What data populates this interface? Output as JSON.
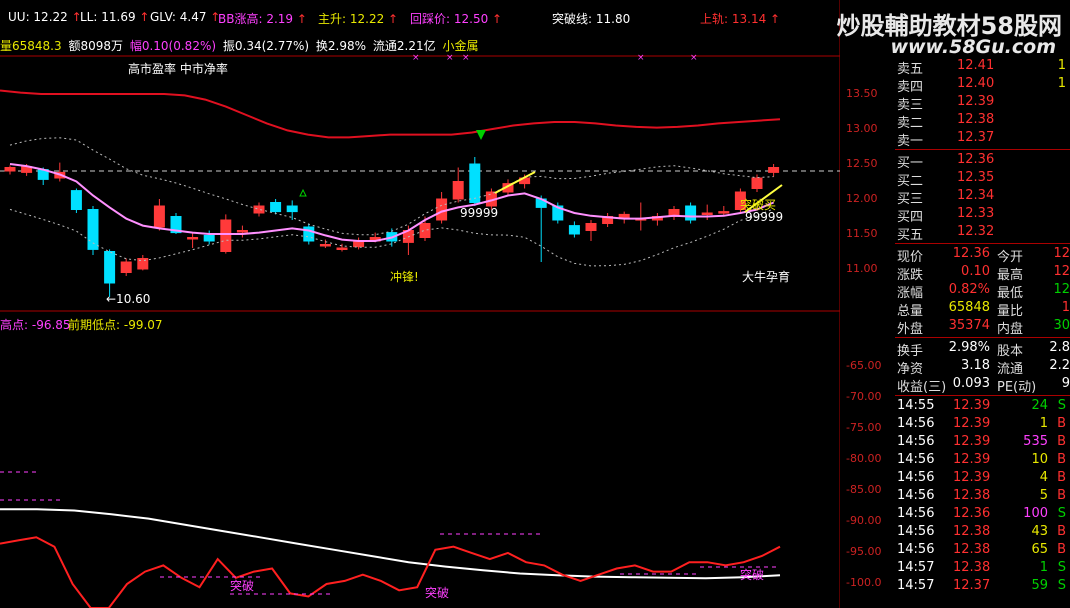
{
  "top_indicators": [
    {
      "label": "UU: 12.22",
      "arrow": "↑",
      "color": "#ffffff"
    },
    {
      "label": "LL: 11.69",
      "arrow": "↑",
      "color": "#ffffff"
    },
    {
      "label": "GLV: 4.47",
      "arrow": "↑",
      "color": "#ffffff"
    },
    {
      "label": "BB涨高: 2.19",
      "arrow": "↑",
      "color": "#ff40ff"
    },
    {
      "label": "主升: 12.22",
      "arrow": "↑",
      "color": "#e8e800"
    },
    {
      "label": "回踩价: 12.50",
      "arrow": "↑",
      "color": "#ff40ff"
    },
    {
      "label": "突破线: 11.80",
      "arrow": "",
      "color": "#ffffff"
    },
    {
      "label": "",
      "arrow": "",
      "color": "#3050ff"
    },
    {
      "label": "上轨: 13.14",
      "arrow": "↑",
      "color": "#ff3030"
    }
  ],
  "watermark": {
    "line1": "炒股輔助教材58股网",
    "line2": "www.58Gu.com"
  },
  "info_line": {
    "volume": "量65848.3",
    "amount": "额8098万",
    "change": "幅0.10(0.82%)",
    "amplitude": "振0.34(2.77%)",
    "turnover": "换2.98%",
    "float": "流通2.21亿",
    "sector": "小金属"
  },
  "chart_labels": {
    "pe_labels": "高市盈率 中市净率",
    "low_label": "←10.60",
    "rush_label": "冲锋!",
    "n99999_a": "99999",
    "n99999_b": "99999",
    "buy_label": "突破买",
    "pattern_label": "大牛孕育"
  },
  "lower_header": {
    "left": "高点: -96.85",
    "right": "前期低点: -99.07"
  },
  "lower_labels": {
    "breakout": "突破"
  },
  "y_axis_upper": [
    "13.50",
    "13.00",
    "12.50",
    "12.00",
    "11.50",
    "11.00"
  ],
  "y_axis_lower": [
    "-65.00",
    "-70.00",
    "-75.00",
    "-80.00",
    "-85.00",
    "-90.00",
    "-95.00",
    "-100.0"
  ],
  "order_book": {
    "asks": [
      {
        "label": "卖五",
        "price": "12.41",
        "vol": "1"
      },
      {
        "label": "卖四",
        "price": "12.40",
        "vol": "1"
      },
      {
        "label": "卖三",
        "price": "12.39",
        "vol": ""
      },
      {
        "label": "卖二",
        "price": "12.38",
        "vol": ""
      },
      {
        "label": "卖一",
        "price": "12.37",
        "vol": ""
      }
    ],
    "bids": [
      {
        "label": "买一",
        "price": "12.36",
        "vol": ""
      },
      {
        "label": "买二",
        "price": "12.35",
        "vol": ""
      },
      {
        "label": "买三",
        "price": "12.34",
        "vol": ""
      },
      {
        "label": "买四",
        "price": "12.33",
        "vol": ""
      },
      {
        "label": "买五",
        "price": "12.32",
        "vol": ""
      }
    ]
  },
  "stats": [
    {
      "l1": "现价",
      "v1": "12.36",
      "l2": "今开",
      "v2": "12"
    },
    {
      "l1": "涨跌",
      "v1": "0.10",
      "l2": "最高",
      "v2": "12"
    },
    {
      "l1": "涨幅",
      "v1": "0.82%",
      "l2": "最低",
      "v2": "12"
    },
    {
      "l1": "总量",
      "v1": "65848",
      "l2": "量比",
      "v2": "1"
    },
    {
      "l1": "外盘",
      "v1": "35374",
      "l2": "内盘",
      "v2": "30"
    }
  ],
  "stats2": [
    {
      "l1": "换手",
      "v1": "2.98%",
      "l2": "股本",
      "v2": "2.8"
    },
    {
      "l1": "净资",
      "v1": "3.18",
      "l2": "流通",
      "v2": "2.2"
    },
    {
      "l1": "收益(三)",
      "v1": "0.093",
      "l2": "PE(动)",
      "v2": "9"
    }
  ],
  "ticks": [
    {
      "time": "14:55",
      "price": "12.39",
      "vol": "24",
      "side": "S"
    },
    {
      "time": "14:56",
      "price": "12.39",
      "vol": "1",
      "side": "B"
    },
    {
      "time": "14:56",
      "price": "12.39",
      "vol": "535",
      "side": "B"
    },
    {
      "time": "14:56",
      "price": "12.39",
      "vol": "10",
      "side": "B"
    },
    {
      "time": "14:56",
      "price": "12.39",
      "vol": "4",
      "side": "B"
    },
    {
      "time": "14:56",
      "price": "12.38",
      "vol": "5",
      "side": "B"
    },
    {
      "time": "14:56",
      "price": "12.36",
      "vol": "100",
      "side": "S"
    },
    {
      "time": "14:56",
      "price": "12.38",
      "vol": "43",
      "side": "B"
    },
    {
      "time": "14:56",
      "price": "12.38",
      "vol": "65",
      "side": "B"
    },
    {
      "time": "14:57",
      "price": "12.38",
      "vol": "1",
      "side": "S"
    },
    {
      "time": "14:57",
      "price": "12.37",
      "vol": "59",
      "side": "S"
    }
  ],
  "candles": [
    {
      "o": 12.4,
      "c": 12.45,
      "h": 12.48,
      "l": 12.35
    },
    {
      "o": 12.38,
      "c": 12.46,
      "h": 12.5,
      "l": 12.33
    },
    {
      "o": 12.42,
      "c": 12.28,
      "h": 12.45,
      "l": 12.2
    },
    {
      "o": 12.3,
      "c": 12.38,
      "h": 12.52,
      "l": 12.25
    },
    {
      "o": 12.12,
      "c": 11.85,
      "h": 12.15,
      "l": 11.8
    },
    {
      "o": 11.85,
      "c": 11.28,
      "h": 11.9,
      "l": 11.2
    },
    {
      "o": 11.25,
      "c": 10.8,
      "h": 11.28,
      "l": 10.6
    },
    {
      "o": 10.95,
      "c": 11.1,
      "h": 11.15,
      "l": 10.9
    },
    {
      "o": 11.0,
      "c": 11.15,
      "h": 11.2,
      "l": 10.98
    },
    {
      "o": 11.6,
      "c": 11.9,
      "h": 12.0,
      "l": 11.55
    },
    {
      "o": 11.75,
      "c": 11.52,
      "h": 11.8,
      "l": 11.5
    },
    {
      "o": 11.45,
      "c": 11.45,
      "h": 11.52,
      "l": 11.3
    },
    {
      "o": 11.48,
      "c": 11.4,
      "h": 11.55,
      "l": 11.35
    },
    {
      "o": 11.25,
      "c": 11.7,
      "h": 11.78,
      "l": 11.22
    },
    {
      "o": 11.55,
      "c": 11.55,
      "h": 11.62,
      "l": 11.45
    },
    {
      "o": 11.8,
      "c": 11.9,
      "h": 11.95,
      "l": 11.75
    },
    {
      "o": 11.95,
      "c": 11.82,
      "h": 12.0,
      "l": 11.78
    },
    {
      "o": 11.9,
      "c": 11.82,
      "h": 11.98,
      "l": 11.7
    },
    {
      "o": 11.6,
      "c": 11.4,
      "h": 11.65,
      "l": 11.35
    },
    {
      "o": 11.35,
      "c": 11.35,
      "h": 11.42,
      "l": 11.3
    },
    {
      "o": 11.3,
      "c": 11.3,
      "h": 11.36,
      "l": 11.25
    },
    {
      "o": 11.32,
      "c": 11.4,
      "h": 11.45,
      "l": 11.28
    },
    {
      "o": 11.4,
      "c": 11.45,
      "h": 11.52,
      "l": 11.38
    },
    {
      "o": 11.52,
      "c": 11.4,
      "h": 11.58,
      "l": 11.32
    },
    {
      "o": 11.38,
      "c": 11.55,
      "h": 11.62,
      "l": 11.2
    },
    {
      "o": 11.45,
      "c": 11.65,
      "h": 11.75,
      "l": 11.4
    },
    {
      "o": 11.7,
      "c": 12.0,
      "h": 12.1,
      "l": 11.65
    },
    {
      "o": 12.0,
      "c": 12.25,
      "h": 12.45,
      "l": 11.95
    },
    {
      "o": 12.5,
      "c": 11.95,
      "h": 12.6,
      "l": 11.9
    },
    {
      "o": 11.9,
      "c": 12.1,
      "h": 12.15,
      "l": 11.85
    },
    {
      "o": 12.1,
      "c": 12.22,
      "h": 12.28,
      "l": 12.05
    },
    {
      "o": 12.22,
      "c": 12.3,
      "h": 12.35,
      "l": 12.15
    },
    {
      "o": 12.0,
      "c": 11.88,
      "h": 12.05,
      "l": 11.1
    },
    {
      "o": 11.9,
      "c": 11.7,
      "h": 11.95,
      "l": 11.65
    },
    {
      "o": 11.62,
      "c": 11.5,
      "h": 11.68,
      "l": 11.45
    },
    {
      "o": 11.55,
      "c": 11.65,
      "h": 11.7,
      "l": 11.4
    },
    {
      "o": 11.65,
      "c": 11.75,
      "h": 11.8,
      "l": 11.6
    },
    {
      "o": 11.72,
      "c": 11.78,
      "h": 11.82,
      "l": 11.65
    },
    {
      "o": 11.72,
      "c": 11.72,
      "h": 11.95,
      "l": 11.55
    },
    {
      "o": 11.7,
      "c": 11.75,
      "h": 11.8,
      "l": 11.62
    },
    {
      "o": 11.75,
      "c": 11.85,
      "h": 11.9,
      "l": 11.7
    },
    {
      "o": 11.9,
      "c": 11.7,
      "h": 11.95,
      "l": 11.65
    },
    {
      "o": 11.8,
      "c": 11.8,
      "h": 11.92,
      "l": 11.7
    },
    {
      "o": 11.82,
      "c": 11.82,
      "h": 11.9,
      "l": 11.75
    },
    {
      "o": 11.85,
      "c": 12.1,
      "h": 12.15,
      "l": 11.8
    },
    {
      "o": 12.15,
      "c": 12.3,
      "h": 12.35,
      "l": 12.1
    },
    {
      "o": 12.38,
      "c": 12.45,
      "h": 12.5,
      "l": 12.32
    }
  ],
  "ma_line": [
    12.5,
    12.47,
    12.42,
    12.35,
    12.25,
    12.05,
    11.88,
    11.72,
    11.62,
    11.58,
    11.55,
    11.52,
    11.5,
    11.5,
    11.5,
    11.52,
    11.55,
    11.58,
    11.55,
    11.48,
    11.42,
    11.4,
    11.4,
    11.45,
    11.55,
    11.7,
    11.82,
    11.88,
    11.92,
    11.98,
    12.05,
    12.08,
    12.0,
    11.88,
    11.8,
    11.76,
    11.74,
    11.72,
    11.72,
    11.74,
    11.76,
    11.75,
    11.75,
    11.76,
    11.8,
    11.85,
    11.95
  ],
  "upper_band": [
    13.55,
    13.52,
    13.5,
    13.5,
    13.5,
    13.5,
    13.5,
    13.5,
    13.5,
    13.48,
    13.42,
    13.32,
    13.2,
    13.08,
    12.98,
    12.92,
    12.88,
    12.88,
    12.9,
    12.92,
    12.92,
    12.92,
    12.92,
    12.95,
    13.0,
    13.05,
    13.08,
    13.1,
    13.1,
    13.08,
    13.05,
    13.03,
    13.02,
    13.03,
    13.05,
    13.08,
    13.1,
    13.12,
    13.14
  ],
  "lower_series_white": [
    -88.0,
    -88.0,
    -88.2,
    -88.8,
    -89.5,
    -90.5,
    -91.5,
    -92.5,
    -93.5,
    -94.5,
    -95.5,
    -96.5,
    -97.2,
    -97.8,
    -98.3,
    -98.6,
    -98.8,
    -98.9,
    -99.0,
    -99.07,
    -98.9,
    -98.6
  ],
  "lower_series_red": [
    -93.5,
    -93.0,
    -92.5,
    -94.0,
    -100.0,
    -106.0,
    -110.0,
    -100.0,
    -98.0,
    -97.0,
    -99.0,
    -100.5,
    -96.0,
    -99.0,
    -98.0,
    -97.5,
    -101.5,
    -102.0,
    -100.0,
    -99.5,
    -98.5,
    -99.5,
    -101.0,
    -100.5,
    -94.5,
    -94.0,
    -95.0,
    -96.0,
    -95.0,
    -96.5,
    -97.0,
    -98.5,
    -99.5,
    -98.5,
    -97.5,
    -97.0,
    -98.0,
    -98.0,
    -96.5,
    -96.5,
    -97.0,
    -96.5,
    -95.5,
    -94.0
  ]
}
